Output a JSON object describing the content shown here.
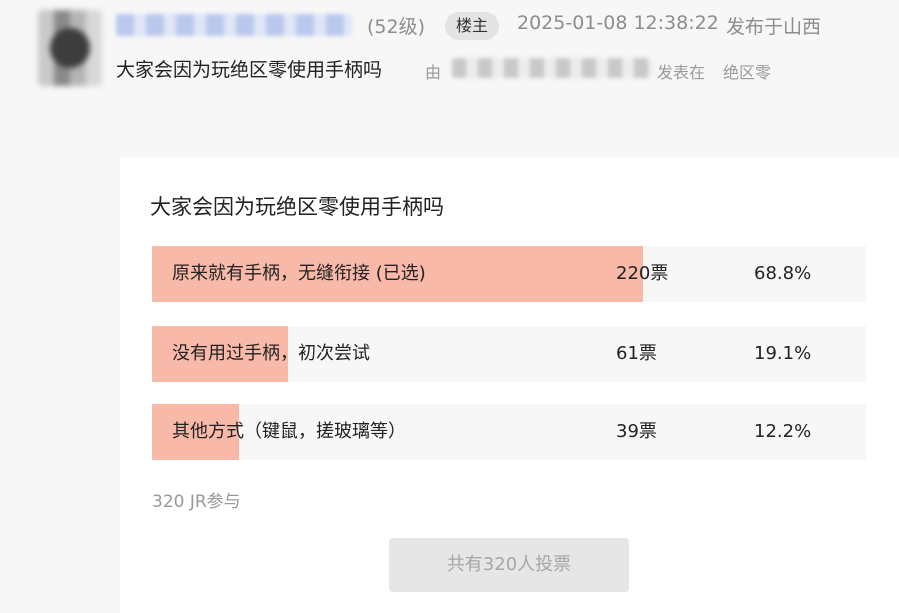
{
  "header": {
    "level": "(52级)",
    "badge": "楼主",
    "datetime": "2025-01-08 12:38:22",
    "location": "发布于山西",
    "thread_title": "大家会因为玩绝区零使用手柄吗",
    "by": "由",
    "posted_in": "发表在",
    "board": "绝区零"
  },
  "poll": {
    "title": "大家会因为玩绝区零使用手柄吗",
    "options": [
      {
        "label": "原来就有手柄，无缝衔接 (已选)",
        "votes": "220票",
        "percent": "68.8%",
        "share": 0.688
      },
      {
        "label": "没有用过手柄，初次尝试",
        "votes": "61票",
        "percent": "19.1%",
        "share": 0.191
      },
      {
        "label": "其他方式（键鼠，搓玻璃等）",
        "votes": "39票",
        "percent": "12.2%",
        "share": 0.122
      }
    ],
    "participants": "320 JR参与",
    "button_label": "共有320人投票"
  },
  "colors": {
    "bar_fill": "#f9b9a9",
    "bar_track": "#f7f7f7",
    "muted_text": "#8d8d8d",
    "button_bg": "#e6e6e6"
  }
}
